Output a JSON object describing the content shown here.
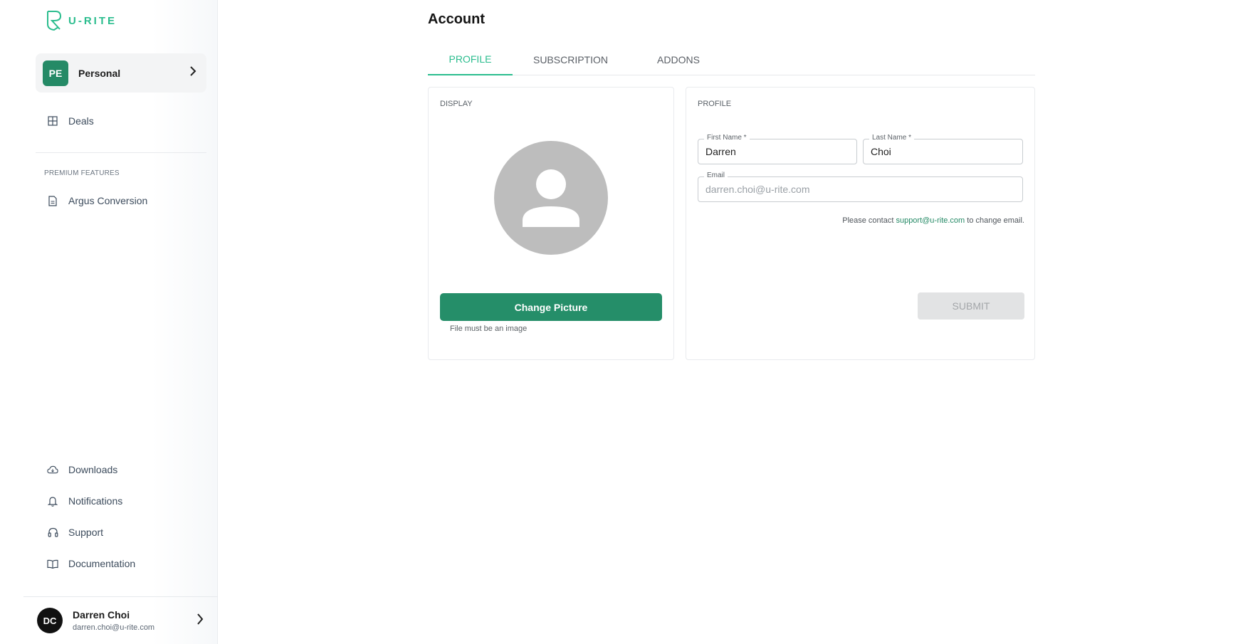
{
  "brand": {
    "logo_text": "U-RITE",
    "accent": "#2bbd8e",
    "primary": "#258e69"
  },
  "workspace": {
    "initials": "PE",
    "name": "Personal",
    "chevron": "›"
  },
  "sidebar": {
    "main_items": [
      {
        "label": "Deals",
        "icon": "grid-icon"
      }
    ],
    "premium_label": "PREMIUM FEATURES",
    "premium_items": [
      {
        "label": "Argus Conversion",
        "icon": "document-icon"
      }
    ],
    "bottom_items": [
      {
        "label": "Downloads",
        "icon": "cloud-download-icon"
      },
      {
        "label": "Notifications",
        "icon": "bell-icon"
      },
      {
        "label": "Support",
        "icon": "headset-icon"
      },
      {
        "label": "Documentation",
        "icon": "book-icon"
      }
    ]
  },
  "user": {
    "initials": "DC",
    "name": "Darren Choi",
    "email": "darren.choi@u-rite.com",
    "chevron": "›"
  },
  "page": {
    "title": "Account",
    "tabs": [
      {
        "label": "PROFILE",
        "active": true
      },
      {
        "label": "SUBSCRIPTION",
        "active": false
      },
      {
        "label": "ADDONS",
        "active": false
      }
    ]
  },
  "display_card": {
    "title": "DISPLAY",
    "button_label": "Change Picture",
    "hint": "File must be an image"
  },
  "profile_card": {
    "title": "PROFILE",
    "first_name": {
      "label": "First Name *",
      "value": "Darren"
    },
    "last_name": {
      "label": "Last Name *",
      "value": "Choi"
    },
    "email": {
      "label": "Email",
      "value": "darren.choi@u-rite.com"
    },
    "email_note_prefix": "Please contact ",
    "email_note_link": "support@u-rite.com",
    "email_note_suffix": " to change email.",
    "submit_label": "SUBMIT"
  }
}
